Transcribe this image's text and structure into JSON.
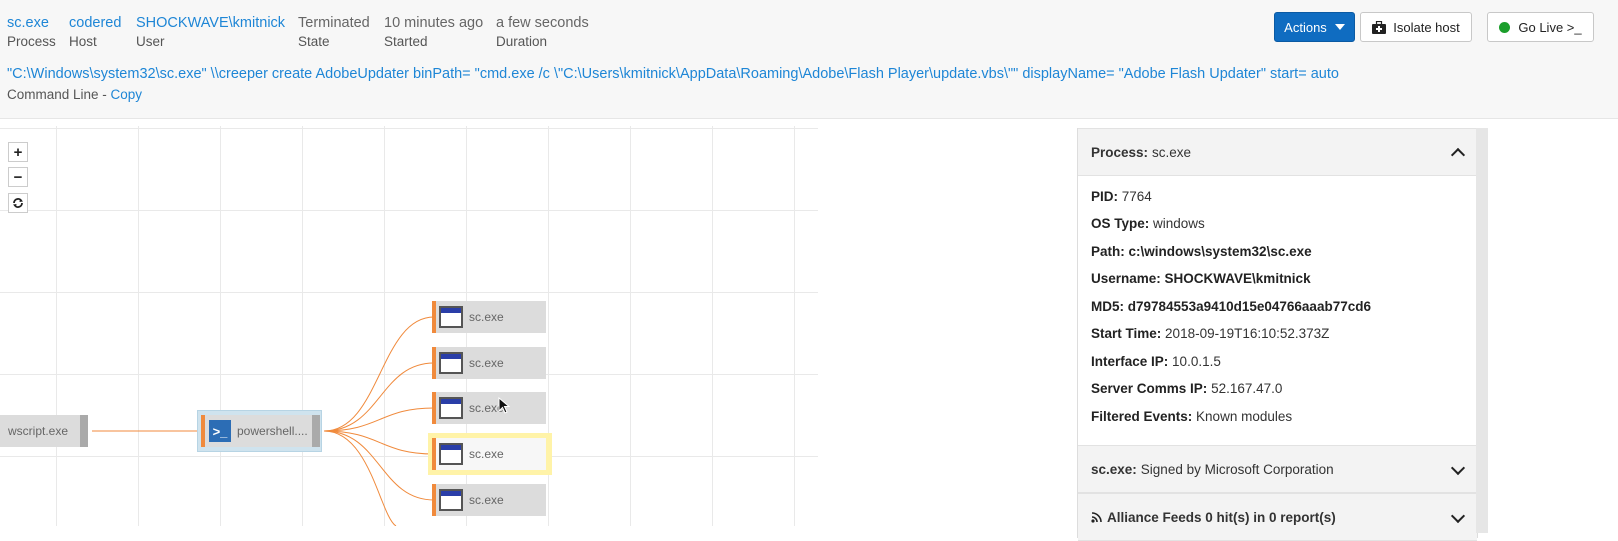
{
  "summary": [
    {
      "value": "sc.exe",
      "label": "Process",
      "link": true
    },
    {
      "value": "codered",
      "label": "Host",
      "link": true
    },
    {
      "value": "SHOCKWAVE\\kmitnick",
      "label": "User",
      "link": true
    },
    {
      "value": "Terminated",
      "label": "State",
      "link": false
    },
    {
      "value": "10 minutes ago",
      "label": "Started",
      "link": false
    },
    {
      "value": "a few seconds",
      "label": "Duration",
      "link": false
    }
  ],
  "actions": {
    "actions_label": "Actions",
    "isolate_label": "Isolate host",
    "golive_label": "Go Live >_"
  },
  "command": {
    "text": "\"C:\\Windows\\system32\\sc.exe\" \\\\creeper create AdobeUpdater binPath= \"cmd.exe /c \\\"C:\\Users\\kmitnick\\AppData\\Roaming\\Adobe\\Flash Player\\update.vbs\\\"\" displayName= \"Adobe Flash Updater\" start= auto",
    "label": "Command Line - ",
    "copy_label": "Copy"
  },
  "graph": {
    "zoom_in": "+",
    "zoom_out": "−",
    "nodes": {
      "wscript": "wscript.exe",
      "powershell": "powershell....",
      "children": [
        "sc.exe",
        "sc.exe",
        "sc.exe",
        "sc.exe",
        "sc.exe"
      ]
    }
  },
  "panel": {
    "process_header": {
      "key": "Process:",
      "value": "sc.exe"
    },
    "fields": [
      {
        "key": "PID:",
        "value": "7764"
      },
      {
        "key": "OS Type:",
        "value": "windows"
      },
      {
        "key": "Path:",
        "value": "c:\\windows\\system32\\sc.exe"
      },
      {
        "key": "Username:",
        "value": "SHOCKWAVE\\kmitnick"
      },
      {
        "key": "MD5:",
        "value": "d79784553a9410d15e04766aaab77cd6"
      },
      {
        "key": "Start Time:",
        "value": "2018-09-19T16:10:52.373Z"
      },
      {
        "key": "Interface IP:",
        "value": "10.0.1.5"
      },
      {
        "key": "Server Comms IP:",
        "value": "52.167.47.0"
      },
      {
        "key": "Filtered Events:",
        "value": "Known modules"
      }
    ],
    "signed_header": {
      "key": "sc.exe:",
      "value": "Signed by Microsoft Corporation"
    },
    "feeds_header": {
      "key": "Alliance Feeds 0 hit(s) in 0 report(s)"
    }
  },
  "colors": {
    "accent": "#1e86d6",
    "primary_button": "#0f6cc1",
    "edge": "#f08a3c",
    "live_dot": "#1b9e2b",
    "selected": "#fff3a8"
  }
}
